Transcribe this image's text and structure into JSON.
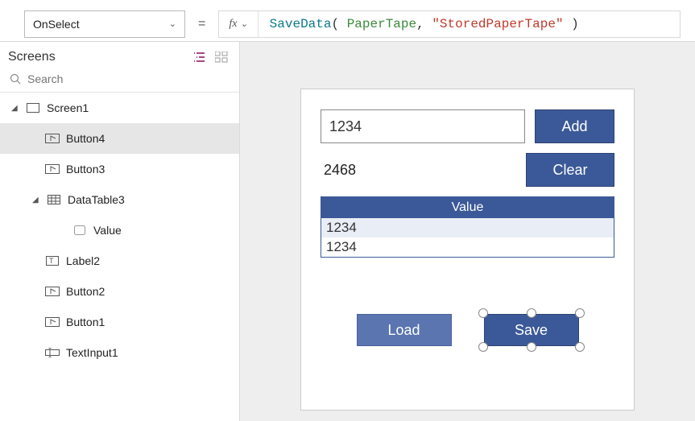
{
  "topbar": {
    "property": "OnSelect",
    "fx_label": "fx",
    "formula": {
      "fn": "SaveData",
      "open": "( ",
      "id": "PaperTape",
      "comma": ", ",
      "str": "\"StoredPaperTape\"",
      "close": " )"
    }
  },
  "sidebar": {
    "title": "Screens",
    "search_placeholder": "Search",
    "tree": {
      "screen1": "Screen1",
      "button4": "Button4",
      "button3": "Button3",
      "datatable3": "DataTable3",
      "value": "Value",
      "label2": "Label2",
      "button2": "Button2",
      "button1": "Button1",
      "textinput1": "TextInput1"
    }
  },
  "app": {
    "input_value": "1234",
    "add_label": "Add",
    "result": "2468",
    "clear_label": "Clear",
    "table_header": "Value",
    "rows": {
      "r0": "1234",
      "r1": "1234"
    },
    "load_label": "Load",
    "save_label": "Save"
  }
}
